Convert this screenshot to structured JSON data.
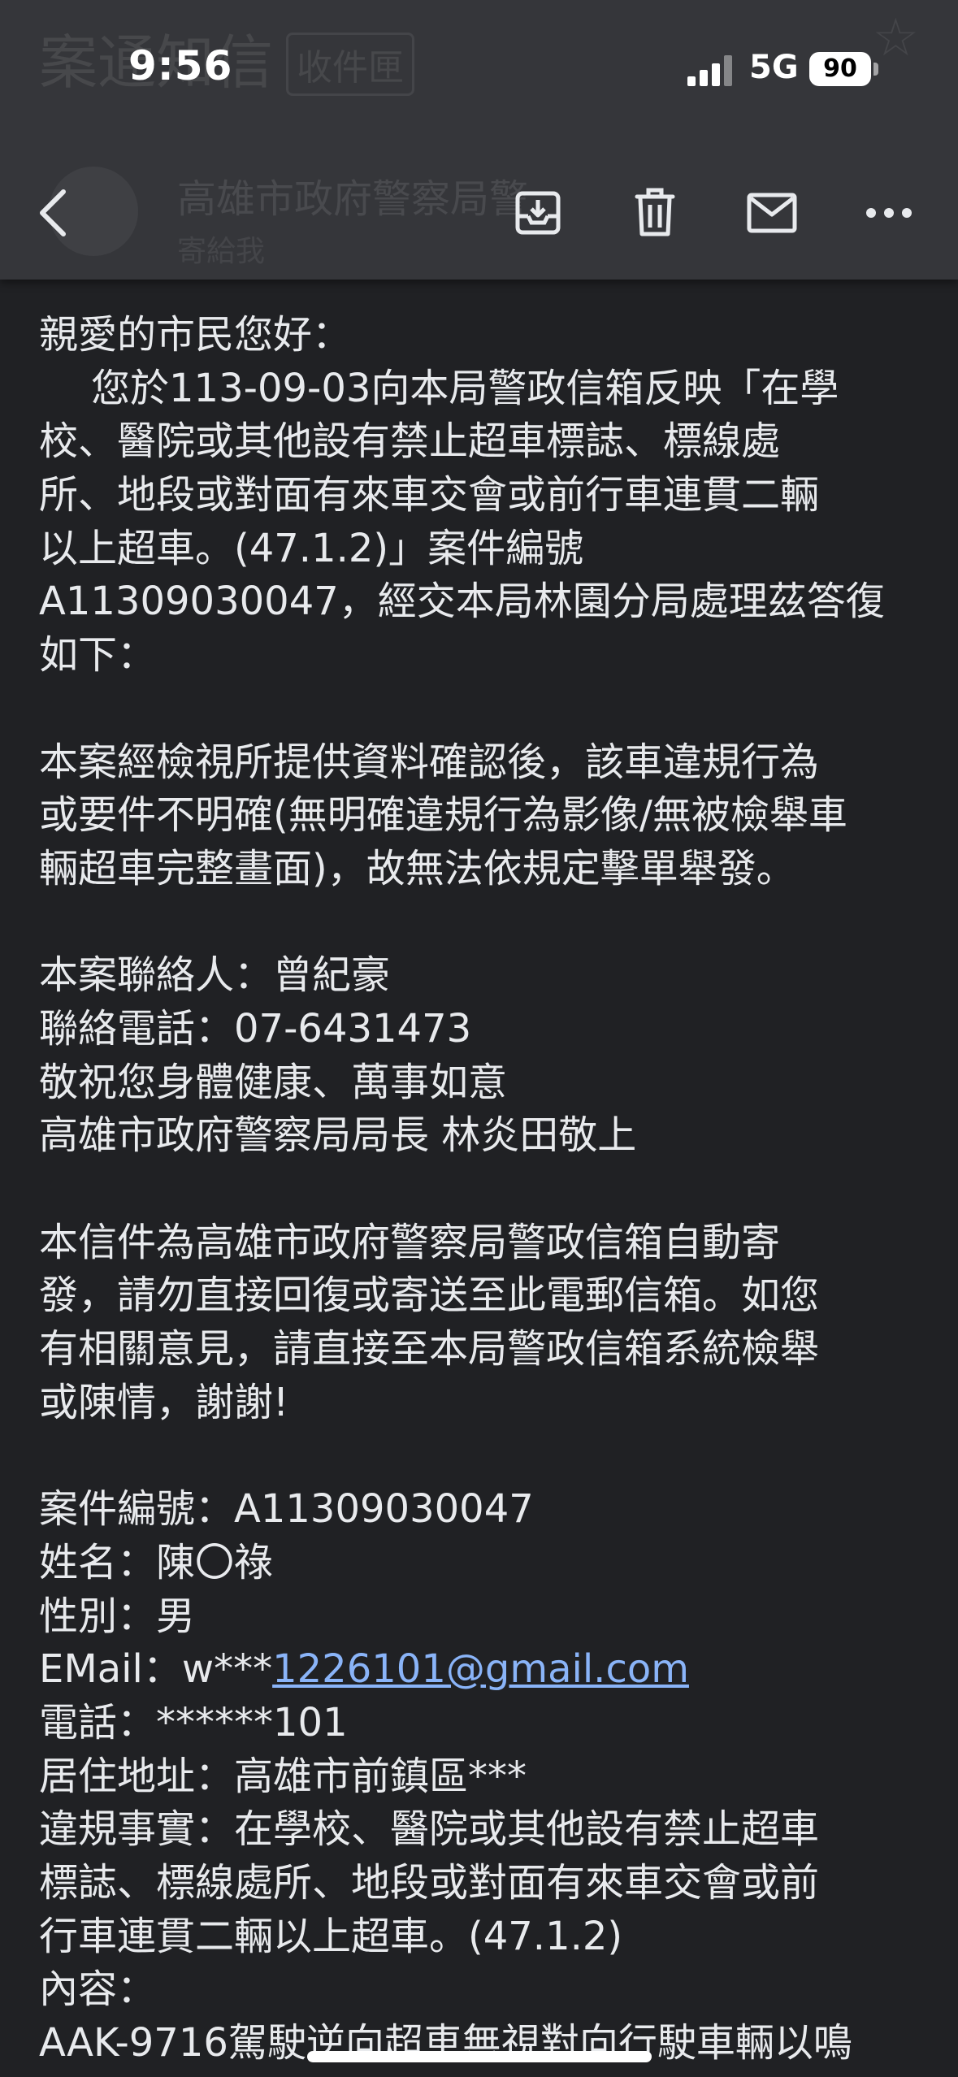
{
  "status_bar": {
    "time": "9:56",
    "network": "5G",
    "battery": "90"
  },
  "header_ghost": {
    "subject": "案通知信",
    "label": "收件匣",
    "sender": "高雄市政府警察局警",
    "to": "寄給我"
  },
  "toolbar": {
    "icons": [
      "back-icon",
      "archive-icon",
      "delete-icon",
      "mark-unread-icon",
      "more-icon"
    ]
  },
  "body": {
    "greeting": "親愛的市民您好：",
    "intro_lines": [
      "您於113-09-03向本局警政信箱反映「在學",
      "校、醫院或其他設有禁止超車標誌、標線處",
      "所、地段或對面有來車交會或前行車連貫二輛",
      "以上超車。(47.1.2)」案件編號",
      "A11309030047，經交本局林園分局處理茲答復",
      "如下："
    ],
    "result_lines": [
      "本案經檢視所提供資料確認後，該車違規行為",
      "或要件不明確(無明確違規行為影像/無被檢舉車",
      "輛超車完整畫面)，故無法依規定擊單舉發。"
    ],
    "contact_person": "本案聯絡人：曾紀豪",
    "contact_phone": "聯絡電話：07-6431473",
    "wishes": "敬祝您身體健康、萬事如意",
    "signature": "高雄市政府警察局局長 林炎田敬上",
    "notice_lines": [
      "本信件為高雄市政府警察局警政信箱自動寄",
      "發，請勿直接回復或寄送至此電郵信箱。如您",
      "有相關意見，請直接至本局警政信箱系統檢舉",
      "或陳情，謝謝!"
    ],
    "case_no": "案件編號：A11309030047",
    "name": "姓名：陳〇祿",
    "gender": "性別：男",
    "email_prefix": "EMail：w***",
    "email_link": "1226101@gmail.com",
    "phone": "電話：******101",
    "address": "居住地址：高雄市前鎮區***",
    "violation_lines": [
      "違規事實：在學校、醫院或其他設有禁止超車",
      "標誌、標線處所、地段或對面有來車交會或前",
      "行車連貫二輛以上超車。(47.1.2)"
    ],
    "content_label": "內容：",
    "content_line": "AAK-9716駕駛逆向超車無視對向行駛車輛以鳴"
  }
}
